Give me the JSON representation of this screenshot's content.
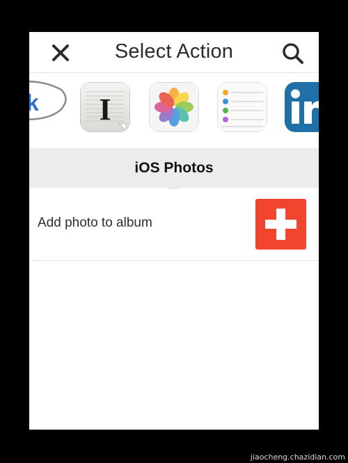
{
  "header": {
    "title": "Select Action",
    "close_icon": "close-icon",
    "search_icon": "search-icon"
  },
  "apps": [
    {
      "name": "Google Talk",
      "icon": "talk-bubble-icon",
      "label_text": "alk"
    },
    {
      "name": "Instapaper",
      "icon": "instapaper-icon",
      "label_text": "I"
    },
    {
      "name": "iOS Photos",
      "icon": "photos-flower-icon",
      "selected": true
    },
    {
      "name": "Reminders",
      "icon": "reminders-list-icon"
    },
    {
      "name": "LinkedIn",
      "icon": "linkedin-icon",
      "label_text": "in"
    }
  ],
  "selected_app": {
    "title": "iOS Photos"
  },
  "actions": [
    {
      "label": "Add photo to album",
      "button_icon": "plus-icon",
      "button_color": "#f1452e"
    }
  ],
  "colors": {
    "background": "#000000",
    "screen": "#ffffff",
    "banner": "#ececec",
    "accent_red": "#f1452e"
  },
  "watermark": "jiaocheng.chazidian.com"
}
